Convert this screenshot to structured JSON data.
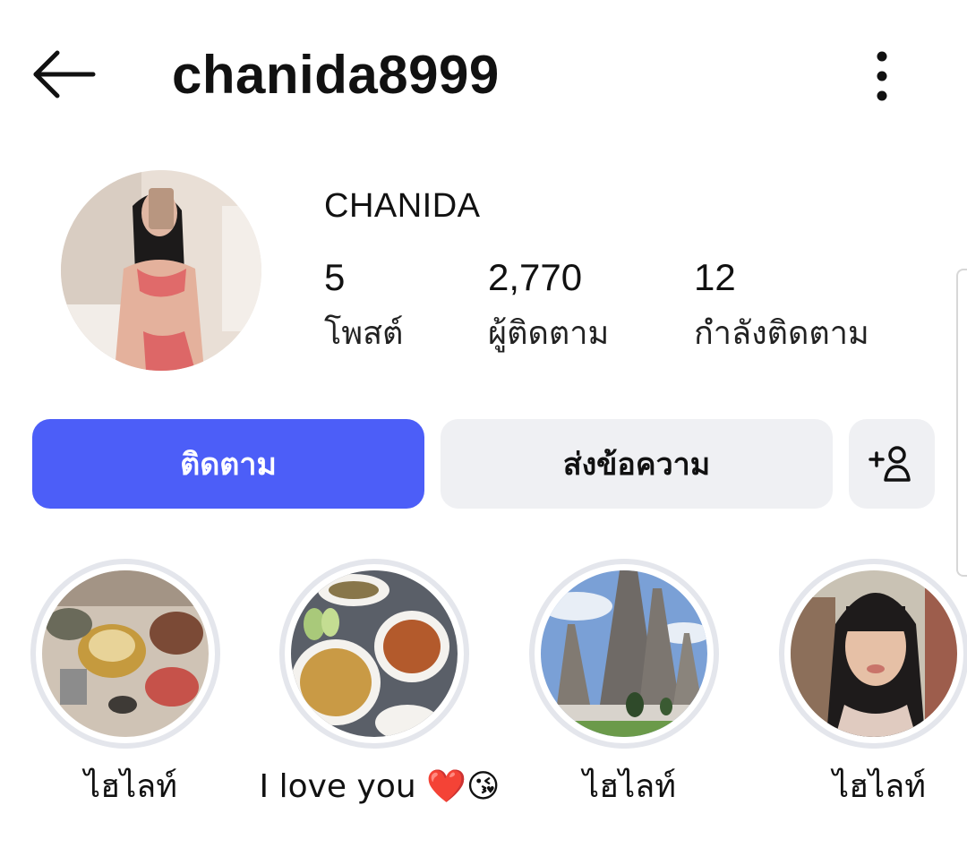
{
  "header": {
    "username": "chanida8999"
  },
  "icons": {
    "back": "arrow-left-icon",
    "more": "more-vertical-icon",
    "add_person": "person-plus-icon"
  },
  "profile": {
    "display_name": "CHANIDA",
    "stats": [
      {
        "value": "5",
        "label": "โพสต์"
      },
      {
        "value": "2,770",
        "label": "ผู้ติดตาม"
      },
      {
        "value": "12",
        "label": "กำลังติดตาม"
      }
    ]
  },
  "buttons": {
    "follow": "ติดตาม",
    "message": "ส่งข้อความ"
  },
  "highlights": [
    {
      "label": "ไฮไลท์"
    },
    {
      "label": "I love you ❤️😘"
    },
    {
      "label": "ไฮไลท์"
    },
    {
      "label": "ไฮไลท์"
    }
  ],
  "colors": {
    "accent": "#4c5ef8",
    "button_bg": "#eff0f3",
    "ring": "#e4e6ec"
  }
}
